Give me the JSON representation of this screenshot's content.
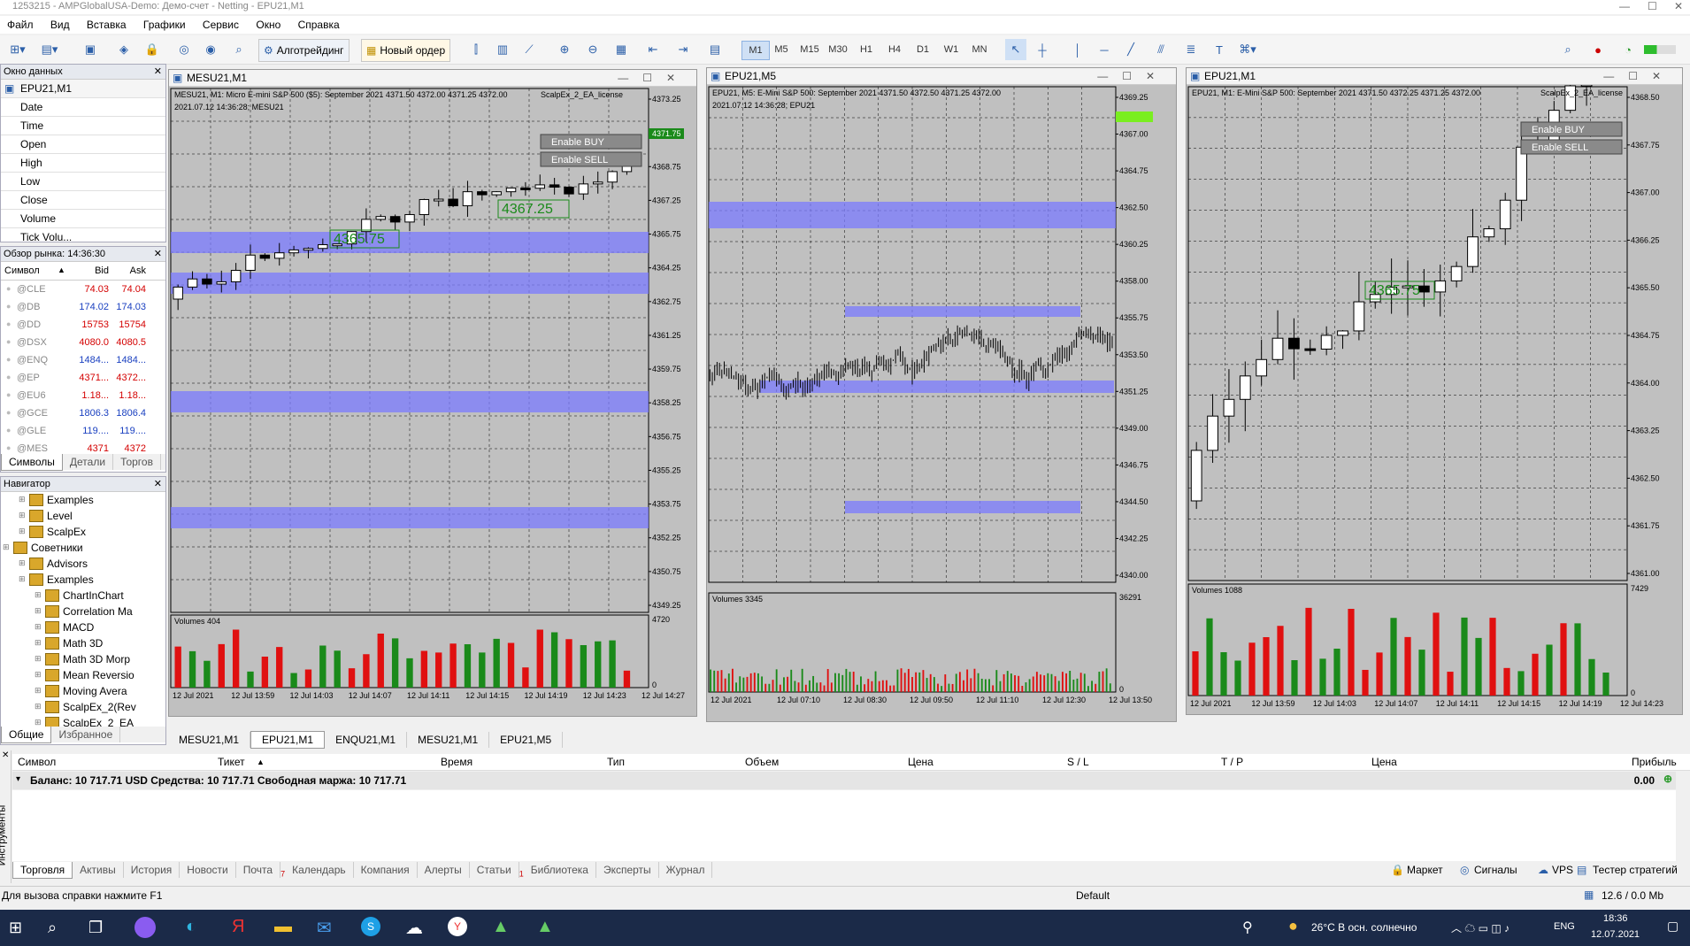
{
  "window": {
    "title": "1253215 - AMPGlobalUSA-Demo: Демо-счет - Netting - EPU21,M1"
  },
  "menu": [
    "Файл",
    "Вид",
    "Вставка",
    "Графики",
    "Сервис",
    "Окно",
    "Справка"
  ],
  "toolbar": {
    "algo_label": "Алготрейдинг",
    "new_order_label": "Новый ордер",
    "timeframes": [
      "M1",
      "M5",
      "M15",
      "M30",
      "H1",
      "H4",
      "D1",
      "W1",
      "MN"
    ],
    "active_timeframe": "M1"
  },
  "data_window": {
    "header": "Окно данных",
    "symbol": "EPU21,M1",
    "rows": [
      "Date",
      "Time",
      "Open",
      "High",
      "Low",
      "Close",
      "Volume",
      "Tick Volu..."
    ]
  },
  "market_watch": {
    "header": "Обзор рынка: 14:36:30",
    "cols": {
      "symbol": "Символ",
      "bid": "Bid",
      "ask": "Ask"
    },
    "rows": [
      {
        "s": "@CLE",
        "b": "74.03",
        "a": "74.04",
        "c": "#d40000"
      },
      {
        "s": "@DB",
        "b": "174.02",
        "a": "174.03",
        "c": "#1a40c0"
      },
      {
        "s": "@DD",
        "b": "15753",
        "a": "15754",
        "c": "#d40000"
      },
      {
        "s": "@DSX",
        "b": "4080.0",
        "a": "4080.5",
        "c": "#d40000"
      },
      {
        "s": "@ENQ",
        "b": "1484...",
        "a": "1484...",
        "c": "#1a40c0"
      },
      {
        "s": "@EP",
        "b": "4371...",
        "a": "4372...",
        "c": "#d40000"
      },
      {
        "s": "@EU6",
        "b": "1.18...",
        "a": "1.18...",
        "c": "#d40000"
      },
      {
        "s": "@GCE",
        "b": "1806.3",
        "a": "1806.4",
        "c": "#1a40c0"
      },
      {
        "s": "@GLE",
        "b": "119....",
        "a": "119....",
        "c": "#1a40c0"
      },
      {
        "s": "@MES",
        "b": "4371",
        "a": "4372",
        "c": "#d40000"
      }
    ],
    "tabs": [
      "Символы",
      "Детали",
      "Торгов"
    ]
  },
  "navigator": {
    "header": "Навигатор",
    "items": [
      {
        "label": "Examples",
        "indent": 1
      },
      {
        "label": "Level",
        "indent": 1
      },
      {
        "label": "ScalpEx",
        "indent": 1
      },
      {
        "label": "Советники",
        "indent": 0
      },
      {
        "label": "Advisors",
        "indent": 1
      },
      {
        "label": "Examples",
        "indent": 1
      },
      {
        "label": "ChartInChart",
        "indent": 2
      },
      {
        "label": "Correlation Ma",
        "indent": 2
      },
      {
        "label": "MACD",
        "indent": 2
      },
      {
        "label": "Math 3D",
        "indent": 2
      },
      {
        "label": "Math 3D Morp",
        "indent": 2
      },
      {
        "label": "Mean Reversio",
        "indent": 2
      },
      {
        "label": "Moving Avera",
        "indent": 2
      },
      {
        "label": "ScalpEx_2(Rev",
        "indent": 2
      },
      {
        "label": "ScalpEx_2_EA",
        "indent": 2
      }
    ],
    "tabs": [
      "Общие",
      "Избранное"
    ]
  },
  "charts": [
    {
      "title": "MESU21,M1",
      "info": "MESU21, M1: Micro E-mini S&P 500 ($5): September 2021  4371.50 4372.00 4371.25 4372.00",
      "date": "2021.07.12 14:36:28; MESU21",
      "ea_label": "ScalpEx_2_EA_license",
      "btn_buy": "Enable BUY",
      "btn_sell": "Enable SELL",
      "price_labels": [
        "4367.25",
        "4365.75"
      ],
      "current_price": "4371.75",
      "yticks": [
        "4373.25",
        "4370.25",
        "4368.75",
        "4367.25",
        "4365.75",
        "4364.25",
        "4362.75",
        "4361.25",
        "4359.75",
        "4358.25",
        "4356.75",
        "4355.25",
        "4353.75",
        "4352.25",
        "4350.75",
        "4349.25"
      ],
      "volume_label": "Volumes 404",
      "volume_max": "4720",
      "volume_zero": "0",
      "xticks": [
        "12 Jul 2021",
        "12 Jul 13:59",
        "12 Jul 14:03",
        "12 Jul 14:07",
        "12 Jul 14:11",
        "12 Jul 14:15",
        "12 Jul 14:19",
        "12 Jul 14:23",
        "12 Jul 14:27"
      ]
    },
    {
      "title": "EPU21,M5",
      "info": "EPU21, M5:  E-Mini S&P 500: September 2021  4371.50 4372.50 4371.25 4372.00",
      "date": "2021.07.12 14:36:28; EPU21",
      "yticks": [
        "4369.25",
        "4367.00",
        "4364.75",
        "4362.50",
        "4360.25",
        "4358.00",
        "4355.75",
        "4353.50",
        "4351.25",
        "4349.00",
        "4346.75",
        "4344.50",
        "4342.25",
        "4340.00"
      ],
      "volume_label": "Volumes 3345",
      "volume_max": "36291",
      "volume_zero": "0",
      "xticks": [
        "12 Jul 2021",
        "12 Jul 07:10",
        "12 Jul 08:30",
        "12 Jul 09:50",
        "12 Jul 11:10",
        "12 Jul 12:30",
        "12 Jul 13:50"
      ]
    },
    {
      "title": "EPU21,M1",
      "info": "EPU21, M1: E-Mini S&P 500: September 2021  4371.50 4372.25 4371.25 4372.00",
      "ea_label": "ScalpEx_2_EA_license",
      "btn_buy": "Enable BUY",
      "btn_sell": "Enable SELL",
      "price_label": "4365.75",
      "yticks": [
        "4368.50",
        "4367.75",
        "4367.00",
        "4366.25",
        "4365.50",
        "4364.75",
        "4364.00",
        "4363.25",
        "4362.50",
        "4361.75",
        "4361.00"
      ],
      "volume_label": "Volumes 1088",
      "volume_max": "7429",
      "volume_zero": "0",
      "xticks": [
        "12 Jul 2021",
        "12 Jul 13:59",
        "12 Jul 14:03",
        "12 Jul 14:07",
        "12 Jul 14:11",
        "12 Jul 14:15",
        "12 Jul 14:19",
        "12 Jul 14:23"
      ]
    }
  ],
  "chart_tabs": [
    "MESU21,M1",
    "EPU21,M1",
    "ENQU21,M1",
    "MESU21,M1",
    "EPU21,M5"
  ],
  "chart_tab_active": 1,
  "trade": {
    "columns": [
      "Символ",
      "Тикет",
      "Время",
      "Тип",
      "Объем",
      "Цена",
      "S / L",
      "T / P",
      "Цена",
      "Прибыль"
    ],
    "balance_text": "Баланс: 10 717.71 USD  Средства: 10 717.71  Свободная маржа: 10 717.71",
    "profit": "0.00"
  },
  "terminal_side_label": "Инструменты",
  "terminal_tabs": [
    "Торговля",
    "Активы",
    "История",
    "Новости",
    "Почта",
    "Календарь",
    "Компания",
    "Алерты",
    "Статьи",
    "Библиотека",
    "Эксперты",
    "Журнал"
  ],
  "terminal_tab_badges": {
    "Почта": "7",
    "Статьи": "1"
  },
  "terminal_right": [
    "Маркет",
    "Сигналы",
    "VPS",
    "Тестер стратегий"
  ],
  "status": {
    "help": "Для вызова справки нажмите F1",
    "profile": "Default",
    "traffic": "12.6 / 0.0 Mb"
  },
  "taskbar": {
    "weather": "26°C  В осн. солнечно",
    "lang": "ENG",
    "time": "18:36",
    "date": "12.07.2021"
  },
  "colors": {
    "bull": "#ffffff",
    "bear": "#000000",
    "vol_up": "#1a8a1a",
    "vol_down": "#e01010",
    "zone": "#7b7bff",
    "chart_bg": "#c0c0c0"
  }
}
